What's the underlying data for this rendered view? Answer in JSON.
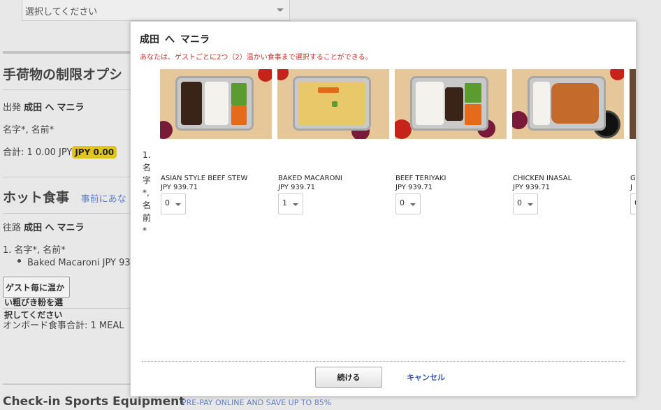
{
  "background": {
    "select_placeholder": "選択してください",
    "baggage_heading": "手荷物の制限オプシ",
    "departure_prefix": "出発",
    "departure_from": "成田",
    "departure_to_word": "へ",
    "departure_to": "マニラ",
    "name_label": "名字*, 名前*",
    "total_label": "合計:",
    "total_value": "1 0.00 JPY",
    "total_badge": "JPY 0.00",
    "hot_meal_heading": "ホット食事",
    "hot_meal_link": "事前にあな",
    "return_prefix": "往路",
    "return_from": "成田",
    "return_to_word": "へ",
    "return_to": "マニラ",
    "passenger_name": "1. 名字*, 名前*",
    "bullet_item": "Baked Macaroni JPY 93",
    "button_line1": "ゲスト毎に温か",
    "button_line2": "い粗びき粉を選",
    "button_line3": "択してください",
    "onboard_total": "オンボード食事合計: 1 MEAL",
    "sports_heading": "Check-in Sports Equipment",
    "sports_link": "PRE-PAY ONLINE AND SAVE UP TO 85%"
  },
  "modal": {
    "title_from": "成田",
    "title_to_word": "へ",
    "title_to": "マニラ",
    "notice": "あなたは、ゲストごとに2つ（2）温かい食事まで選択することができる。",
    "passenger_label": "1. 名字*, 名前*",
    "meals": [
      {
        "name": "ASIAN STYLE BEEF STEW",
        "price": "JPY 939.71",
        "qty": "0"
      },
      {
        "name": "BAKED MACARONI",
        "price": "JPY 939.71",
        "qty": "1"
      },
      {
        "name": "BEEF TERIYAKI",
        "price": "JPY 939.71",
        "qty": "0"
      },
      {
        "name": "CHICKEN INASAL",
        "price": "JPY 939.71",
        "qty": "0"
      },
      {
        "name": "G",
        "price": "J",
        "qty": "0"
      }
    ],
    "continue_label": "続ける",
    "cancel_label": "キャンセル"
  },
  "colors": {
    "notice_red": "#c0392b",
    "badge_yellow": "#e2c420",
    "link_blue": "#3557b7"
  }
}
